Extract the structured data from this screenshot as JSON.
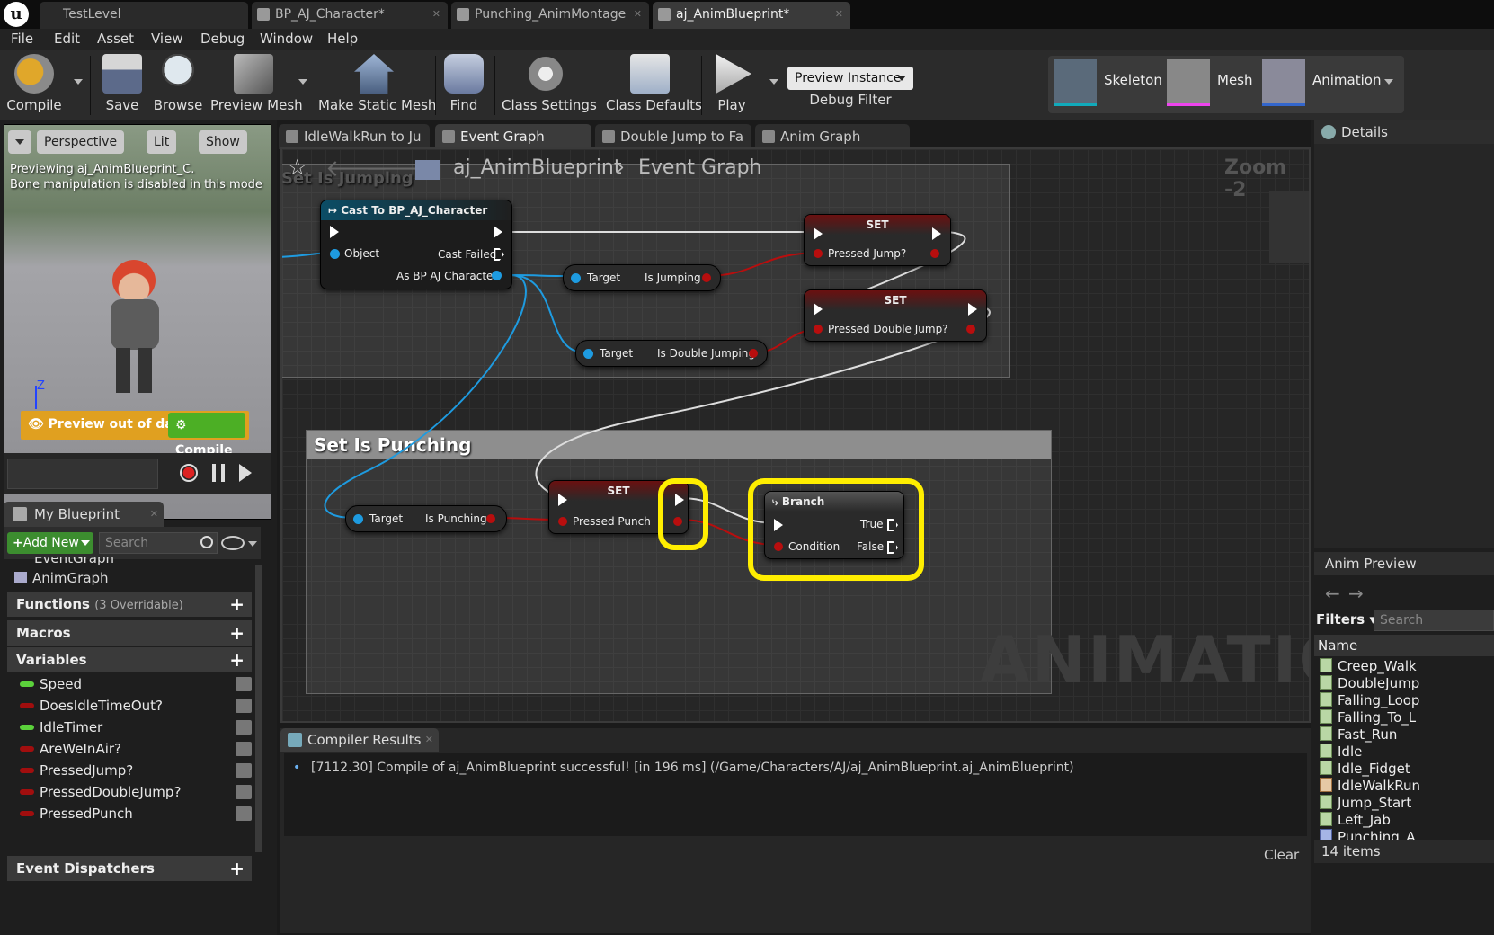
{
  "doc_tabs": [
    {
      "label": "TestLevel"
    },
    {
      "label": "BP_AJ_Character*"
    },
    {
      "label": "Punching_AnimMontage"
    },
    {
      "label": "aj_AnimBlueprint*"
    }
  ],
  "menu": [
    "File",
    "Edit",
    "Asset",
    "View",
    "Debug",
    "Window",
    "Help"
  ],
  "toolbar": {
    "compile": "Compile",
    "save": "Save",
    "browse": "Browse",
    "preview_mesh": "Preview Mesh",
    "make_static_mesh": "Make Static Mesh",
    "find": "Find",
    "class_settings": "Class Settings",
    "class_defaults": "Class Defaults",
    "play": "Play",
    "preview_instance": "Preview Instance",
    "debug_filter": "Debug Filter",
    "skeleton": "Skeleton",
    "mesh": "Mesh",
    "animation": "Animation"
  },
  "viewport": {
    "perspective": "Perspective",
    "lit": "Lit",
    "show": "Show",
    "info_line1": "Previewing aj_AnimBlueprint_C.",
    "info_line2": "Bone manipulation is disabled in this mode",
    "axis_label": "Z",
    "preview_out_of_date": "Preview out of date",
    "compile": "Compile"
  },
  "my_blueprint": {
    "title": "My Blueprint",
    "add_new": "Add New",
    "search_placeholder": "Search",
    "graphs": [
      "EventGraph",
      "AnimGraph"
    ],
    "functions": "Functions",
    "functions_note": "(3 Overridable)",
    "macros": "Macros",
    "variables": "Variables",
    "variable_items": [
      {
        "name": "Speed",
        "color": "#5bd13b"
      },
      {
        "name": "DoesIdleTimeOut?",
        "color": "#a10e0e"
      },
      {
        "name": "IdleTimer",
        "color": "#5bd13b"
      },
      {
        "name": "AreWeInAir?",
        "color": "#a10e0e"
      },
      {
        "name": "PressedJump?",
        "color": "#a10e0e"
      },
      {
        "name": "PressedDoubleJump?",
        "color": "#a10e0e"
      },
      {
        "name": "PressedPunch",
        "color": "#a10e0e"
      }
    ],
    "event_dispatchers": "Event Dispatchers"
  },
  "graph_tabs": [
    {
      "label": "IdleWalkRun to Ju"
    },
    {
      "label": "Event Graph"
    },
    {
      "label": "Double Jump to Fa"
    },
    {
      "label": "Anim Graph"
    }
  ],
  "graph": {
    "breadcrumb_root": "aj_AnimBlueprint",
    "breadcrumb_leaf": "Event Graph",
    "zoom": "Zoom -2",
    "watermark": "ANIMATION",
    "comment_jumping": "Set Is Jumping",
    "comment_punching": "Set Is Punching",
    "cast_node": {
      "title": "Cast To BP_AJ_Character",
      "object": "Object",
      "cast_failed": "Cast Failed",
      "as_char": "As BP AJ Character"
    },
    "get_jumping": {
      "target": "Target",
      "value": "Is Jumping"
    },
    "get_double_jumping": {
      "target": "Target",
      "value": "Is Double Jumping"
    },
    "get_punching": {
      "target": "Target",
      "value": "Is Punching"
    },
    "set_jump": {
      "title": "SET",
      "pin": "Pressed Jump?"
    },
    "set_double_jump": {
      "title": "SET",
      "pin": "Pressed Double Jump?"
    },
    "set_punch": {
      "title": "SET",
      "pin": "Pressed Punch"
    },
    "branch": {
      "title": "Branch",
      "true": "True",
      "condition": "Condition",
      "false": "False"
    }
  },
  "compiler": {
    "tab": "Compiler Results",
    "message": "[7112.30] Compile of aj_AnimBlueprint successful! [in 196 ms] (/Game/Characters/AJ/aj_AnimBlueprint.aj_AnimBlueprint)",
    "clear": "Clear"
  },
  "details": {
    "title": "Details"
  },
  "anim_preview": {
    "title": "Anim Preview",
    "filters": "Filters",
    "search_placeholder": "Search",
    "name_col": "Name",
    "items": [
      "Creep_Walk",
      "DoubleJump",
      "Falling_Loop",
      "Falling_To_L",
      "Fast_Run",
      "Idle",
      "Idle_Fidget",
      "IdleWalkRun",
      "Jump_Start",
      "Left_Jab",
      "Punching_A"
    ],
    "count": "14 items"
  }
}
